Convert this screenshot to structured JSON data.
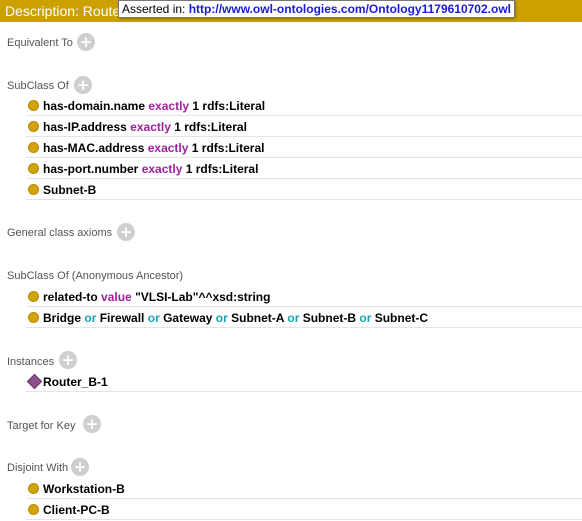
{
  "header": {
    "title": "Description: Router_B",
    "tooltip_prefix": "Asserted in:",
    "tooltip_url": "http://www.owl-ontologies.com/Ontology1179610702.owl"
  },
  "sections": {
    "equivalent_to": "Equivalent To",
    "subclass_of": "SubClass Of",
    "general_class_axioms": "General class axioms",
    "subclass_of_anon": "SubClass Of (Anonymous Ancestor)",
    "instances": "Instances",
    "target_for_key": "Target for Key",
    "disjoint_with": "Disjoint With"
  },
  "subclass_of": [
    {
      "prop": "has-domain.name",
      "kw": "exactly",
      "rest": "1 rdfs:Literal"
    },
    {
      "prop": "has-IP.address",
      "kw": "exactly",
      "rest": "1 rdfs:Literal"
    },
    {
      "prop": "has-MAC.address",
      "kw": "exactly",
      "rest": "1 rdfs:Literal"
    },
    {
      "prop": "has-port.number",
      "kw": "exactly",
      "rest": "1 rdfs:Literal"
    },
    {
      "prop": "Subnet-B"
    }
  ],
  "anon_ancestor": {
    "related": {
      "prop": "related-to",
      "kw": "value",
      "rest": "\"VLSI-Lab\"^^xsd:string"
    },
    "union": {
      "classes": [
        "Bridge",
        "Firewall",
        "Gateway",
        "Subnet-A",
        "Subnet-B",
        "Subnet-C"
      ],
      "op": "or"
    }
  },
  "instances": [
    "Router_B-1"
  ],
  "disjoint_with": [
    "Workstation-B",
    "Client-PC-B"
  ],
  "icons": {
    "add": "add-icon",
    "class": "class-icon",
    "individual": "individual-icon"
  },
  "colors": {
    "header": "#cca000",
    "class_dot": "#d4a30b",
    "individual": "#8b4f8b",
    "keyword_restriction": "#a020a0",
    "keyword_or": "#1aa0b8",
    "url": "#1a1ad6"
  }
}
